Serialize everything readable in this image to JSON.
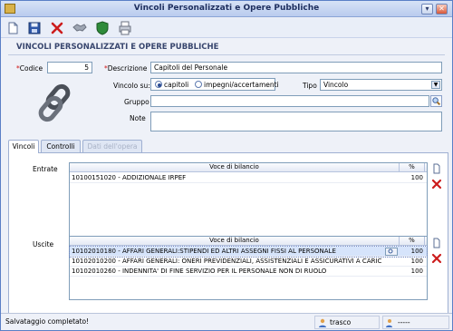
{
  "window": {
    "title": "Vincoli Personalizzati e Opere Pubbliche"
  },
  "toolbar": {
    "icons": [
      "new-document-icon",
      "save-icon",
      "delete-icon",
      "handshake-icon",
      "shield-icon",
      "print-icon"
    ]
  },
  "header": {
    "title": "VINCOLI PERSONALIZZATI E OPERE PUBBLICHE"
  },
  "form": {
    "codice_label": "Codice",
    "codice_value": "5",
    "descrizione_label": "Descrizione",
    "descrizione_value": "Capitoli del Personale",
    "vincolo_su_label": "Vincolo su:",
    "radio_capitoli": "capitoli",
    "radio_impegni": "impegni/accertamenti",
    "tipo_label": "Tipo",
    "tipo_value": "Vincolo",
    "gruppo_label": "Gruppo",
    "gruppo_value": "",
    "note_label": "Note",
    "note_value": ""
  },
  "tabs": [
    {
      "label": "Vincoli",
      "state": "active"
    },
    {
      "label": "Controlli",
      "state": "normal"
    },
    {
      "label": "Dati dell'opera",
      "state": "disabled"
    }
  ],
  "entrate": {
    "label": "Entrate",
    "columns": [
      "Voce di bilancio",
      "%"
    ],
    "rows": [
      {
        "voce": "10100151020 - ADDIZIONALE IRPEF",
        "pct": "100"
      }
    ]
  },
  "uscite": {
    "label": "Uscite",
    "columns": [
      "Voce di bilancio",
      "%"
    ],
    "rows": [
      {
        "voce": "10102010180 - AFFARI GENERALI:STIPENDI ED ALTRI ASSEGNI FISSI AL PERSONALE",
        "pct": "100",
        "selected": true
      },
      {
        "voce": "10102010200 - AFFARI GENERALI: ONERI PREVIDENZIALI, ASSISTENZIALI E ASSICURATIVI A CARIC",
        "pct": "100",
        "selected": false
      },
      {
        "voce": "10102010260 - INDENNITA' DI FINE SERVIZIO PER IL PERSONALE NON DI RUOLO",
        "pct": "100",
        "selected": false
      }
    ]
  },
  "status": {
    "message": "Salvataggio completato!",
    "user": "trasco",
    "extra": "-----"
  },
  "colors": {
    "accent": "#38466e",
    "delete": "#d01515",
    "selection": "#d6e4fb"
  }
}
